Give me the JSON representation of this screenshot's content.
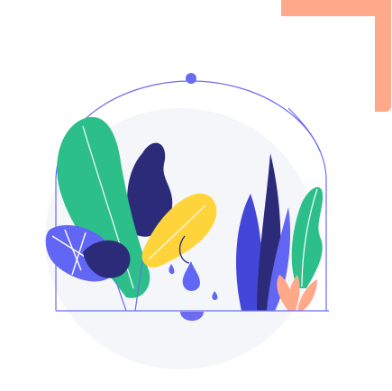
{
  "illustration": {
    "subject": "plant-terrarium",
    "colors": {
      "background_circle": "#f4f5f9",
      "corner_accent": "#ffa98a",
      "dome_outline": "#6b6cf0",
      "dome_knob": "#6b6cf0",
      "green_leaf": "#2dbf8a",
      "green_leaf_dark": "#1f9e72",
      "navy_leaf": "#2c2b7a",
      "blue_leaf": "#4347d9",
      "violet_leaf": "#6166f5",
      "yellow_leaf": "#ffd43b",
      "orange_leaf": "#ffa98a",
      "water_drop": "#6166f5",
      "base_shadow": "#dfe1ef",
      "stroke_light": "#ffffff"
    }
  }
}
